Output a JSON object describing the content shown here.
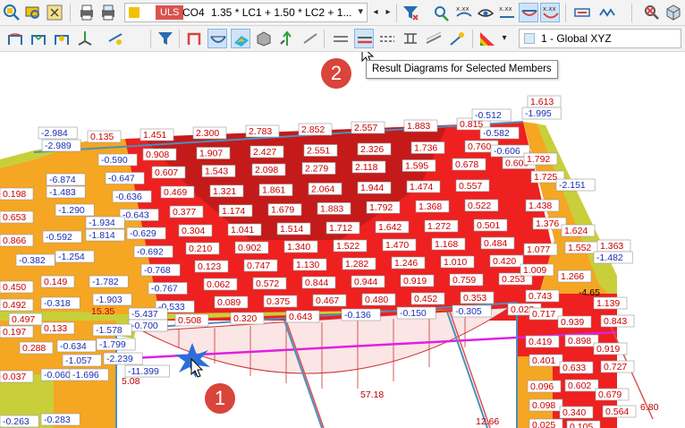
{
  "toolbar": {
    "load_combo": {
      "type": "ULS",
      "code": "CO4",
      "formula": "1.35 * LC1 + 1.50 * LC2 + 1...",
      "arrow": "▾"
    },
    "nav_prev": "◂",
    "nav_next": "▸",
    "coord_system": "1 - Global XYZ",
    "active_tool": "result-diagrams-selected-members",
    "icon_names": [
      "deformed-shape-icon",
      "results-icon",
      "values-icon",
      "filter-icon",
      "section-icon",
      "diagram-icon",
      "surface-results-icon",
      "solid-results-icon",
      "support-reactions-icon",
      "result-diagrams-selected-members-icon",
      "color-scale-icon"
    ]
  },
  "tooltip": "Result Diagrams for Selected Members",
  "steps": [
    "1",
    "2"
  ],
  "colors": {
    "dark_red": "#c41a1a",
    "red": "#ee2020",
    "orange": "#f5a623",
    "yellow_green": "#c9cf3a",
    "label_red": "#cc0000",
    "label_blue": "#1a2fb5",
    "diagram_magenta": "#e020e0",
    "member_blue": "#4a90c0"
  },
  "labels": {
    "top_row": [
      "0.135",
      "1.451",
      "2.300",
      "2.783",
      "2.852",
      "2.557",
      "1.883",
      "0.815"
    ],
    "row2": [
      "0.908",
      "1.907",
      "2.427",
      "2.551",
      "2.326",
      "1.736",
      "0.760"
    ],
    "row3": [
      "0.607",
      "1.543",
      "2.098",
      "2.279",
      "2.118",
      "1.595",
      "0.678",
      "0.609"
    ],
    "row4": [
      "0.469",
      "1.321",
      "1.861",
      "2.064",
      "1.944",
      "1.474",
      "0.557"
    ],
    "row5": [
      "0.377",
      "1.174",
      "1.679",
      "1.883",
      "1.792",
      "1.368",
      "0.522"
    ],
    "row6": [
      "0.304",
      "1.041",
      "1.514",
      "1.712",
      "1.642",
      "1.272",
      "0.501"
    ],
    "row7": [
      "0.210",
      "0.902",
      "1.340",
      "1.522",
      "1.470",
      "1.168",
      "0.484"
    ],
    "row8": [
      "0.123",
      "0.747",
      "1.130",
      "1.282",
      "1.246",
      "1.010",
      "0.420"
    ],
    "row9": [
      "0.062",
      "0.572",
      "0.844",
      "0.944",
      "0.919",
      "0.759",
      "0.253"
    ],
    "row10": [
      "0.089",
      "0.375",
      "0.467",
      "0.480",
      "0.452",
      "0.353"
    ],
    "row11": [
      "0.508",
      "0.320",
      "0.643",
      "-0.136",
      "-0.150",
      "-0.305",
      "0.023"
    ],
    "blue_top": [
      "-2.984",
      "-2.989",
      "-0.512",
      "-0.582",
      "-0.606"
    ],
    "blue_left": [
      "-0.590",
      "-0.647",
      "-0.636",
      "-0.643",
      "-0.629",
      "-0.692",
      "-0.768",
      "-0.767",
      "-0.533"
    ],
    "left_col1": [
      "-6.874",
      "-1.483",
      "-1.290",
      "-1.934",
      "-1.814",
      "-1.254",
      "-1.782",
      "-1.903",
      "-5.437",
      "-0.700"
    ],
    "left_col2": [
      "-0.592",
      "-0.382",
      "0.149",
      "-0.318",
      "0.133",
      "-1.578",
      "-1.799",
      "-2.239",
      "-11.399"
    ],
    "far_left": [
      "0.198",
      "0.653",
      "0.866",
      "0.450",
      "0.492",
      "0.497",
      "0.197",
      "0.288",
      "-0.634",
      "-1.057",
      "-0.060",
      "-1.696",
      "0.037",
      "-0.263",
      "-0.283"
    ],
    "right_top": [
      "1.613",
      "-1.995"
    ],
    "right_col": [
      "1.792",
      "1.725",
      "-2.151",
      "1.438",
      "1.376",
      "1.624",
      "1.077",
      "1.552",
      "1.363",
      "-1.482",
      "1.009",
      "1.266",
      "0.743",
      "1.139",
      "0.717",
      "0.939",
      "0.843",
      "0.419",
      "0.898",
      "0.919",
      "0.401",
      "0.633",
      "0.727",
      "0.096",
      "0.602",
      "0.679",
      "0.098",
      "0.340",
      "0.564",
      "0.025",
      "0.105"
    ],
    "member_values": [
      "-4.65",
      "15.35",
      "5.08",
      "57.18",
      "12.66",
      "6.80"
    ]
  }
}
